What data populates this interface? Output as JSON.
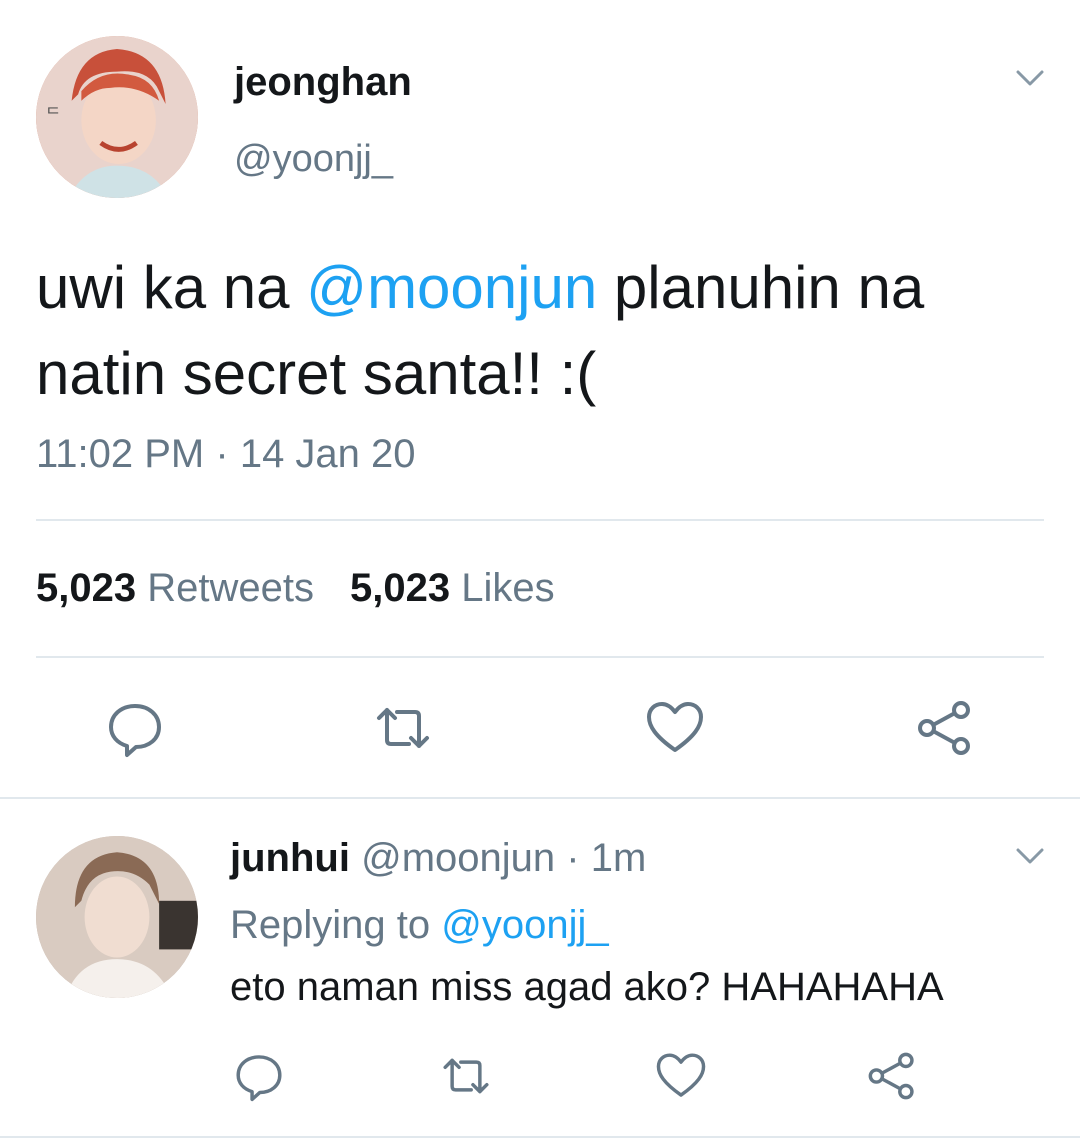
{
  "tweet": {
    "author": {
      "name": "jeonghan",
      "handle": "@yoonjj_"
    },
    "text_before": "uwi ka na ",
    "mention": "@moonjun",
    "text_after": " planuhin na natin secret santa!! :(",
    "time": "11:02 PM",
    "separator": "·",
    "date": "14 Jan 20",
    "retweets": {
      "count": "5,023",
      "label": "Retweets"
    },
    "likes": {
      "count": "5,023",
      "label": "Likes"
    }
  },
  "reply": {
    "name": "junhui",
    "handle": "@moonjun",
    "separator": "·",
    "age": "1m",
    "replying_label": "Replying to",
    "replying_handle": "@yoonjj_",
    "text": "eto naman miss agad ako? HAHAHAHA"
  },
  "icons": {
    "reply": "reply-icon",
    "retweet": "retweet-icon",
    "like": "heart-icon",
    "share": "share-icon",
    "menu": "chevron-down-icon"
  },
  "colors": {
    "text": "#14171a",
    "secondary": "#657786",
    "link": "#1da1f2",
    "divider": "#e1e8ed"
  }
}
